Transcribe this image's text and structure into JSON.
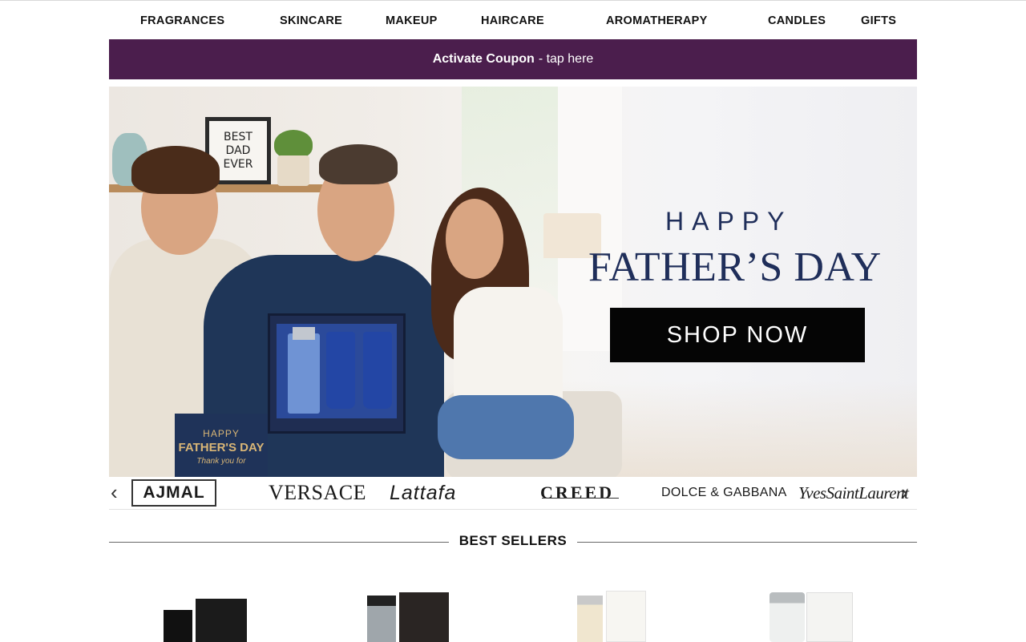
{
  "nav": {
    "items": [
      "FRAGRANCES",
      "SKINCARE",
      "MAKEUP",
      "HAIRCARE",
      "AROMATHERAPY",
      "CANDLES",
      "GIFTS"
    ]
  },
  "coupon": {
    "bold": "Activate Coupon",
    "rest": "- tap here"
  },
  "hero": {
    "frame_text": [
      "BEST",
      "DAD",
      "EVER"
    ],
    "card": {
      "line1": "HAPPY",
      "line2": "FATHER'S DAY",
      "line3": "Thank you for"
    },
    "headline_small": "HAPPY",
    "headline_large": "FATHER’S DAY",
    "cta": "SHOP NOW"
  },
  "brands": {
    "prev_arrow": "‹",
    "next_arrow": "›",
    "items": [
      "AJMAL",
      "VERSACE",
      "Lattafa",
      "CREED",
      "DOLCE & GABBANA",
      "YvesSaintLaurent"
    ]
  },
  "best_sellers": {
    "title": "BEST SELLERS"
  },
  "colors": {
    "coupon_bg": "#4b1e4d",
    "headline": "#1f2e5a",
    "cta_bg": "#050505"
  }
}
